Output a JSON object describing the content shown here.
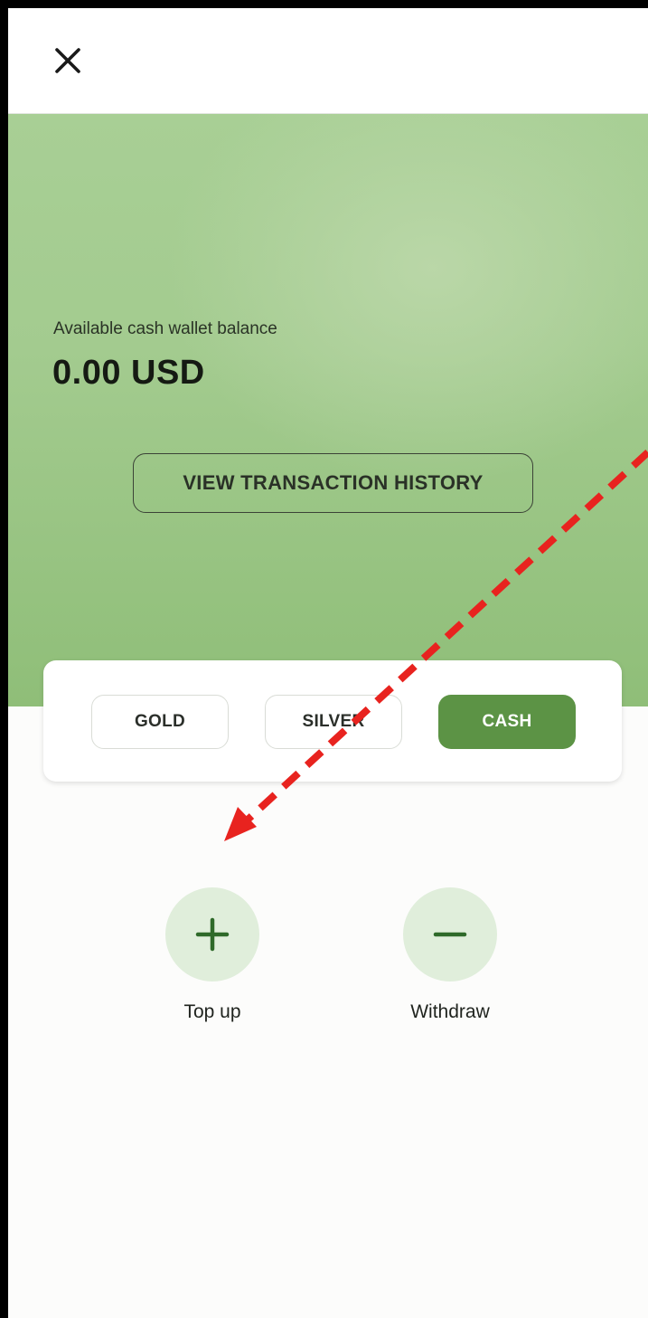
{
  "header": {
    "close_icon": "close-icon"
  },
  "wallet": {
    "balance_label": "Available cash wallet balance",
    "balance_value": "0.00 USD",
    "history_button": "VIEW TRANSACTION HISTORY"
  },
  "segments": {
    "items": [
      "GOLD",
      "SILVER",
      "CASH"
    ],
    "selected": "CASH"
  },
  "actions": {
    "top_up": {
      "label": "Top up",
      "icon": "plus-icon"
    },
    "withdraw": {
      "label": "Withdraw",
      "icon": "minus-icon"
    }
  },
  "colors": {
    "accent": "#5c9345",
    "action_icon": "#2f6a2a",
    "annotation_arrow": "#e8231f"
  }
}
